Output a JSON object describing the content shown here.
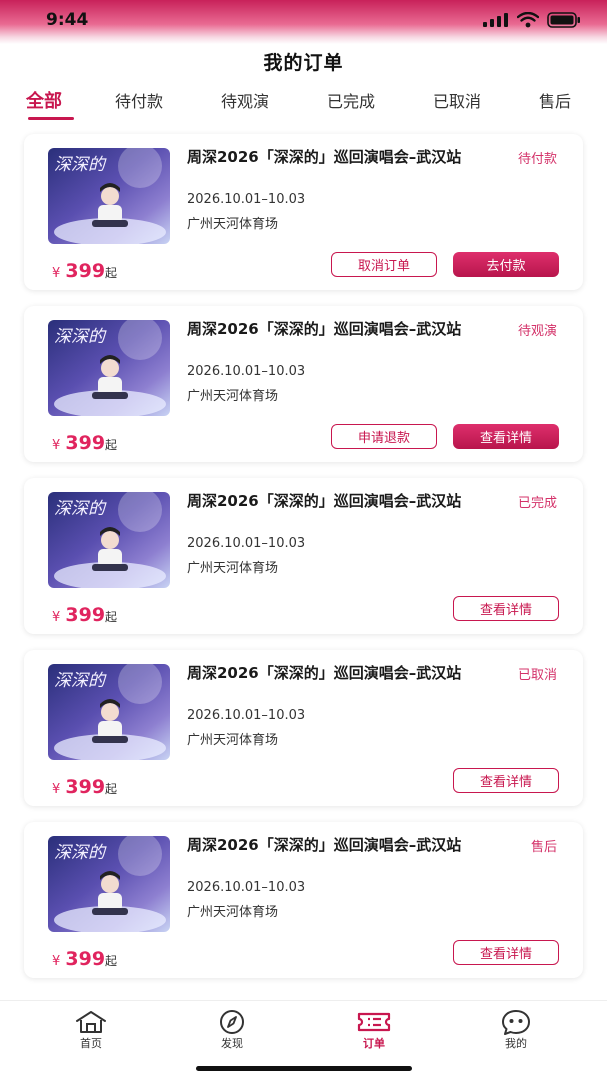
{
  "status_bar": {
    "time": "9:44"
  },
  "header": {
    "title": "我的订单"
  },
  "tabs": [
    {
      "label": "全部",
      "active": true
    },
    {
      "label": "待付款",
      "active": false
    },
    {
      "label": "待观演",
      "active": false
    },
    {
      "label": "已完成",
      "active": false
    },
    {
      "label": "已取消",
      "active": false
    },
    {
      "label": "售后",
      "active": false
    }
  ],
  "orders": [
    {
      "title": "周深2026「深深的」巡回演唱会–武汉站",
      "date": "2026.10.01–10.03",
      "venue": "广州天河体育场",
      "status": "待付款",
      "price_symbol": "¥",
      "price": "399",
      "price_suffix": "起",
      "buttons": [
        "取消订单",
        "去付款"
      ]
    },
    {
      "title": "周深2026「深深的」巡回演唱会–武汉站",
      "date": "2026.10.01–10.03",
      "venue": "广州天河体育场",
      "status": "待观演",
      "price_symbol": "¥",
      "price": "399",
      "price_suffix": "起",
      "buttons": [
        "申请退款",
        "查看详情"
      ]
    },
    {
      "title": "周深2026「深深的」巡回演唱会–武汉站",
      "date": "2026.10.01–10.03",
      "venue": "广州天河体育场",
      "status": "已完成",
      "price_symbol": "¥",
      "price": "399",
      "price_suffix": "起",
      "buttons": [
        "查看详情"
      ]
    },
    {
      "title": "周深2026「深深的」巡回演唱会–武汉站",
      "date": "2026.10.01–10.03",
      "venue": "广州天河体育场",
      "status": "已取消",
      "price_symbol": "¥",
      "price": "399",
      "price_suffix": "起",
      "buttons": [
        "查看详情"
      ]
    },
    {
      "title": "周深2026「深深的」巡回演唱会–武汉站",
      "date": "2026.10.01–10.03",
      "venue": "广州天河体育场",
      "status": "售后",
      "price_symbol": "¥",
      "price": "399",
      "price_suffix": "起",
      "buttons": [
        "查看详情"
      ]
    }
  ],
  "nav": [
    {
      "label": "首页",
      "icon": "home-icon",
      "active": false
    },
    {
      "label": "发现",
      "icon": "compass-icon",
      "active": false
    },
    {
      "label": "订单",
      "icon": "order-list-icon",
      "active": true
    },
    {
      "label": "我的",
      "icon": "profile-face-icon",
      "active": false
    }
  ],
  "colors": {
    "accent": "#c8174f",
    "status_text": "#d4336a",
    "price": "#e0245e"
  }
}
